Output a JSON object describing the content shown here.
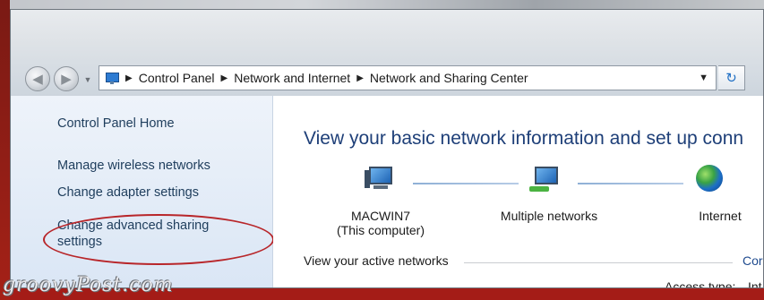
{
  "addressbar": {
    "crumbs": [
      "Control Panel",
      "Network and Internet",
      "Network and Sharing Center"
    ]
  },
  "sidebar": {
    "items": [
      {
        "label": "Control Panel Home"
      },
      {
        "label": "Manage wireless networks"
      },
      {
        "label": "Change adapter settings"
      },
      {
        "label": "Change advanced sharing settings",
        "label_line1": "Change advanced sharing",
        "label_line2": "settings"
      }
    ]
  },
  "main": {
    "title": "View your basic network information and set up conn",
    "map": {
      "nodes": [
        {
          "label_line1": "MACWIN7",
          "label_line2": "(This computer)",
          "icon": "computer-icon"
        },
        {
          "label_line1": "Multiple networks",
          "icon": "network-icon"
        },
        {
          "label_line1": "Internet",
          "icon": "globe-icon"
        }
      ]
    },
    "active_networks": {
      "title": "View your active networks",
      "link": "Cor",
      "access_type_label": "Access type:",
      "access_type_value": "Int"
    }
  },
  "watermark": "groovyPost.com",
  "colors": {
    "accent": "#1e3f78",
    "link": "#1e3d5c",
    "highlight_ring": "#b8262a"
  }
}
